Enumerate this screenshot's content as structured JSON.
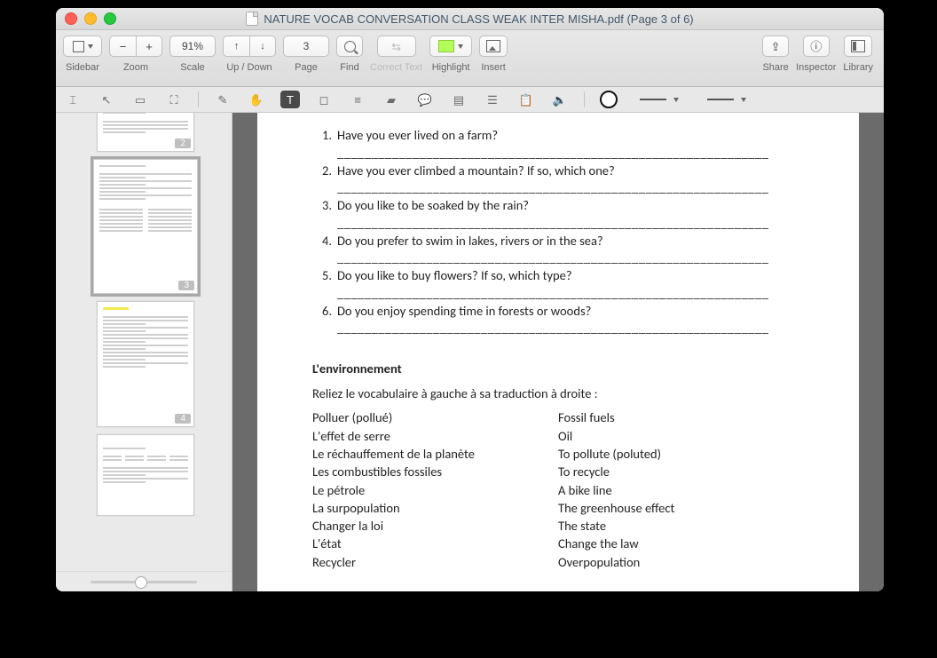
{
  "window": {
    "title": "NATURE VOCAB CONVERSATION CLASS WEAK INTER MISHA.pdf (Page 3 of 6)"
  },
  "toolbar": {
    "sidebar_label": "Sidebar",
    "zoom_label": "Zoom",
    "zoom_minus": "−",
    "zoom_plus": "+",
    "scale_label": "Scale",
    "scale_value": "91%",
    "updown_label": "Up / Down",
    "page_label": "Page",
    "page_value": "3",
    "find_label": "Find",
    "correct_label": "Correct Text",
    "highlight_label": "Highlight",
    "insert_label": "Insert",
    "share_label": "Share",
    "inspector_label": "Inspector",
    "library_label": "Library"
  },
  "thumbs": [
    {
      "num": "2",
      "highlight": false
    },
    {
      "num": "3",
      "highlight": false
    },
    {
      "num": "4",
      "highlight": true
    },
    {
      "num": "",
      "highlight": false
    }
  ],
  "doc": {
    "questions": [
      {
        "n": "1.",
        "t": "Have you ever lived on a farm?"
      },
      {
        "n": "2.",
        "t": "Have you ever climbed a mountain? If so, which one?"
      },
      {
        "n": "3.",
        "t": "Do you like to be soaked by the rain?"
      },
      {
        "n": "4.",
        "t": "Do you prefer to swim in lakes, rivers or in the sea?"
      },
      {
        "n": "5.",
        "t": "Do you like to buy flowers? If so, which type?"
      },
      {
        "n": "6.",
        "t": "Do you enjoy spending time in forests or woods?"
      }
    ],
    "rule": "_______________________________________________________________",
    "section_title": "L'environnement",
    "match_intro": "Reliez le vocabulaire à gauche à sa traduction à droite :",
    "left": [
      "Polluer (pollué)",
      "L'effet de serre",
      "Le réchauffement de la planète",
      "Les combustibles fossiles",
      "Le pétrole",
      "La surpopulation",
      "Changer la loi",
      "L'état",
      "Recycler"
    ],
    "right": [
      "Fossil fuels",
      "Oil",
      "To pollute (poluted)",
      "To recycle",
      "A bike line",
      "The greenhouse effect",
      "The state",
      "Change the law",
      "Overpopulation"
    ]
  }
}
